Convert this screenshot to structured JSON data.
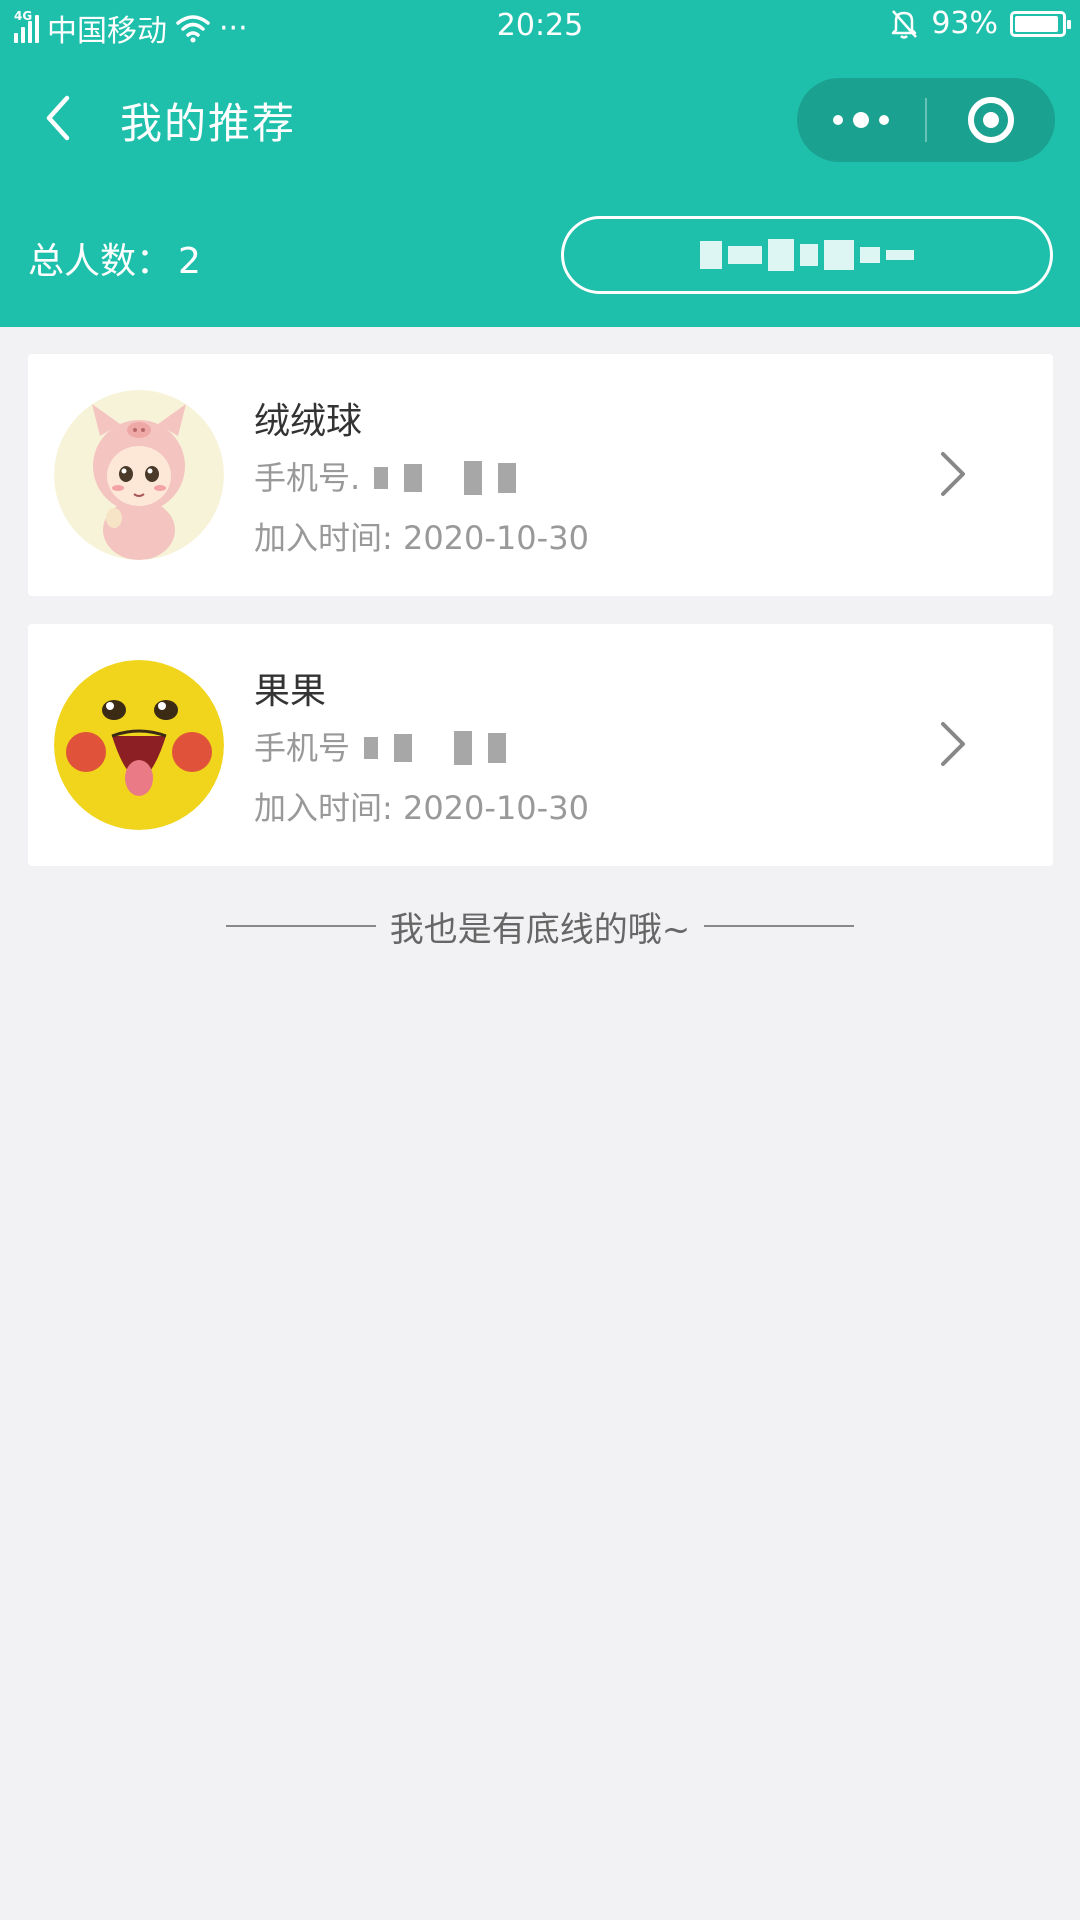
{
  "status_bar": {
    "network": "4G",
    "carrier": "中国移动",
    "extra": "···",
    "time": "20:25",
    "battery_text": "93%",
    "battery_level": 0.93
  },
  "navbar": {
    "title": "我的推荐"
  },
  "summary": {
    "total_label": "总人数：",
    "total_count": "2"
  },
  "members": [
    {
      "name": "绒绒球",
      "phone_label": "手机号.",
      "joined": "加入时间: 2020-10-30"
    },
    {
      "name": "果果",
      "phone_label": "手机号",
      "joined": "加入时间: 2020-10-30"
    }
  ],
  "footer": {
    "text": "我也是有底线的哦~"
  },
  "colors": {
    "primary": "#1fc0ab",
    "background": "#f2f2f4"
  }
}
